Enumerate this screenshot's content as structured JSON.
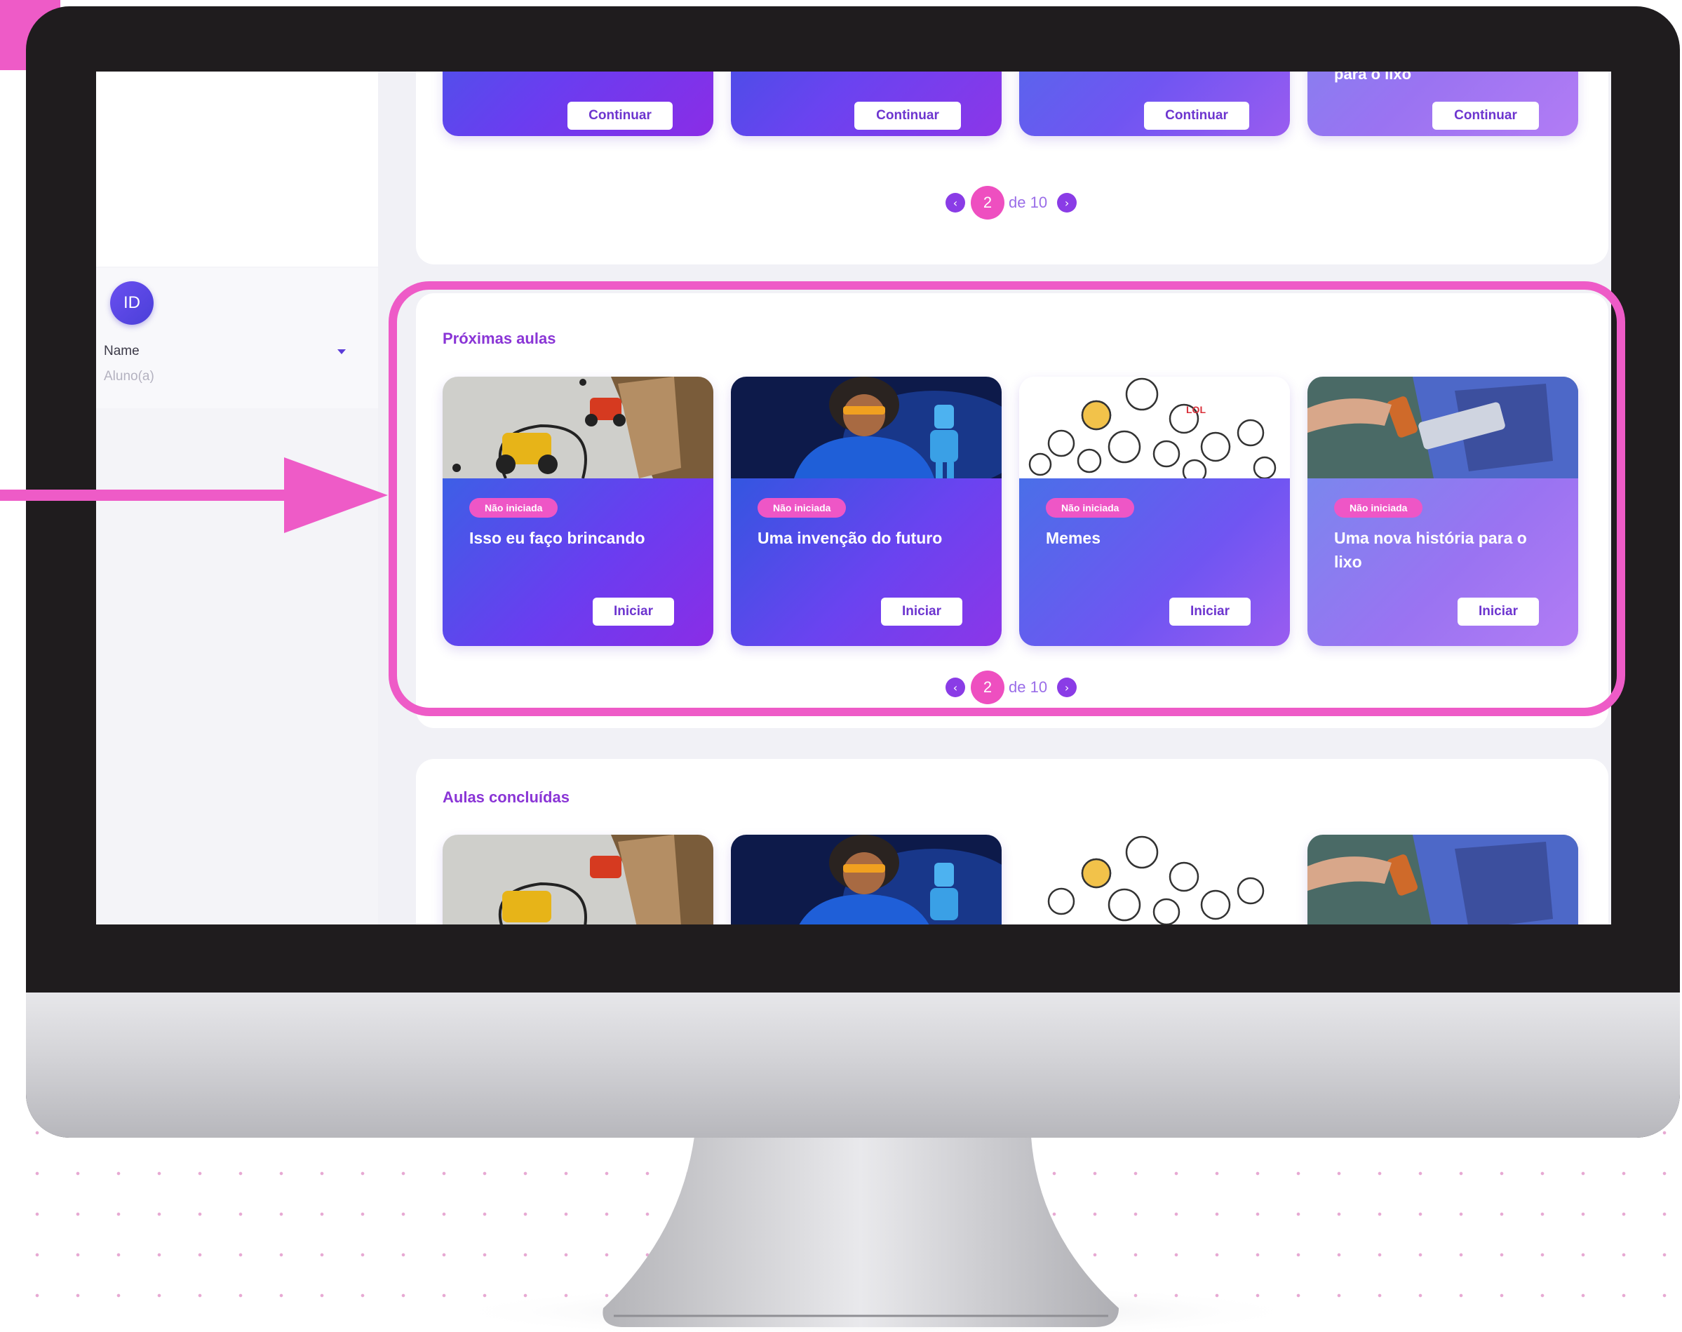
{
  "sidebar": {
    "avatar_initials": "ID",
    "user_name": "Name",
    "user_role": "Aluno(a)"
  },
  "in_progress": {
    "cards": [
      {
        "title": "",
        "button": "Continuar"
      },
      {
        "title": "",
        "button": "Continuar"
      },
      {
        "title": "",
        "button": "Continuar"
      },
      {
        "title": "para o lixo",
        "button": "Continuar"
      }
    ],
    "pagination": {
      "current": "2",
      "of": "de 10",
      "prev_icon": "chevron-left",
      "next_icon": "chevron-right"
    }
  },
  "upcoming": {
    "title": "Próximas aulas",
    "cards": [
      {
        "badge": "Não iniciada",
        "title": "Isso eu faço brincando",
        "button": "Iniciar",
        "image": "toy-car-photo"
      },
      {
        "badge": "Não iniciada",
        "title": "Uma invenção do futuro",
        "button": "Iniciar",
        "image": "man-with-robot-photo"
      },
      {
        "badge": "Não iniciada",
        "title": "Memes",
        "button": "Iniciar",
        "image": "memes-collage"
      },
      {
        "badge": "Não iniciada",
        "title": "Uma nova história para o lixo",
        "button": "Iniciar",
        "image": "recycling-box-photo"
      }
    ],
    "pagination": {
      "current": "2",
      "of": "de 10",
      "prev_icon": "chevron-left",
      "next_icon": "chevron-right"
    }
  },
  "completed": {
    "title": "Aulas concluídas"
  },
  "colors": {
    "accent_pink": "#ee5bc7",
    "accent_purple": "#8a35d6",
    "monitor_bezel": "#1f1c1e"
  }
}
